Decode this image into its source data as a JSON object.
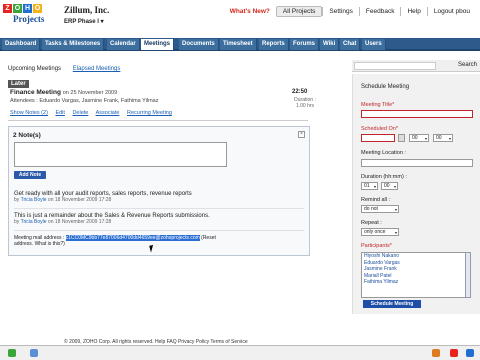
{
  "header": {
    "logo_letters": [
      "Z",
      "O",
      "H",
      "O"
    ],
    "logo_word": "Projects",
    "company": "Zillum, Inc.",
    "project": "ERP Phase I ▾",
    "links": [
      "What's New?",
      "All Projects",
      "Settings",
      "Feedback",
      "Help",
      "Logout pbou"
    ]
  },
  "tabs": [
    "Dashboard",
    "Tasks & Milestones",
    "Calendar",
    "Meetings",
    "Documents",
    "Timesheet",
    "Reports",
    "Forums",
    "Wiki",
    "Chat",
    "Users"
  ],
  "active_tab": "Meetings",
  "subtabs": {
    "upcoming": "Upcoming Meetings",
    "elapsed": "Elapsed Meetings"
  },
  "meeting": {
    "section": "Later",
    "title": "Finance Meeting",
    "date": "on 25 November 2009",
    "attendees": "Attendees : Eduardo Vargas, Jasmine Frank, Fathima Yilmaz",
    "time": "22:50",
    "duration_label": "Duration :",
    "duration": "1.00 hrs",
    "actions": [
      "Show Notes (2)",
      "Edit",
      "Delete",
      "Associate",
      "Recurring Meeting"
    ]
  },
  "notes": {
    "heading": "2 Note(s)",
    "add_button": "Add Note",
    "items": [
      {
        "text": "Get ready with all your audit reports, sales reports, revenue reports",
        "by_prefix": "by",
        "author": "Tricia Boyle",
        "when": "on 18 November 2009 17:28"
      },
      {
        "text": "This is just a remainder about the Sales & Revenue Reports submissions.",
        "by_prefix": "by",
        "author": "Tricia Boyle",
        "when": "on 18 November 2009 17:28"
      }
    ],
    "mail_prefix": "Meeting mail address :",
    "mail_address": "c1CC0MC9bb77e87006d4700dd4659ee@zohoprojects.com",
    "mail_suffix": "(Reset",
    "mail_note": "address. What is this?)"
  },
  "right_panel": {
    "search": "Search",
    "heading": "Schedule Meeting",
    "meeting_title": "Meeting Title*",
    "scheduled_on": "Scheduled On*",
    "hour": "00",
    "minute": "00",
    "location": "Meeting Location :",
    "duration_label": "Duration (hh:mm) :",
    "duration_h": "01",
    "duration_m": "00",
    "remind_label": "Remind all :",
    "remind_value": "do not",
    "repeat_label": "Repeat :",
    "repeat_value": "only once",
    "participants_label": "Participants*",
    "participants": [
      "Hiyoshi Nakano",
      "Eduardo Vargas",
      "Jasmine Frank",
      "Mariall Patel",
      "Fathima Yilmaz"
    ],
    "schedule_button": "Schedule Meeting"
  },
  "footer": "© 2009, ZOHO Corp. All rights reserved.   Help   FAQ   Privacy Policy   Terms of Service"
}
